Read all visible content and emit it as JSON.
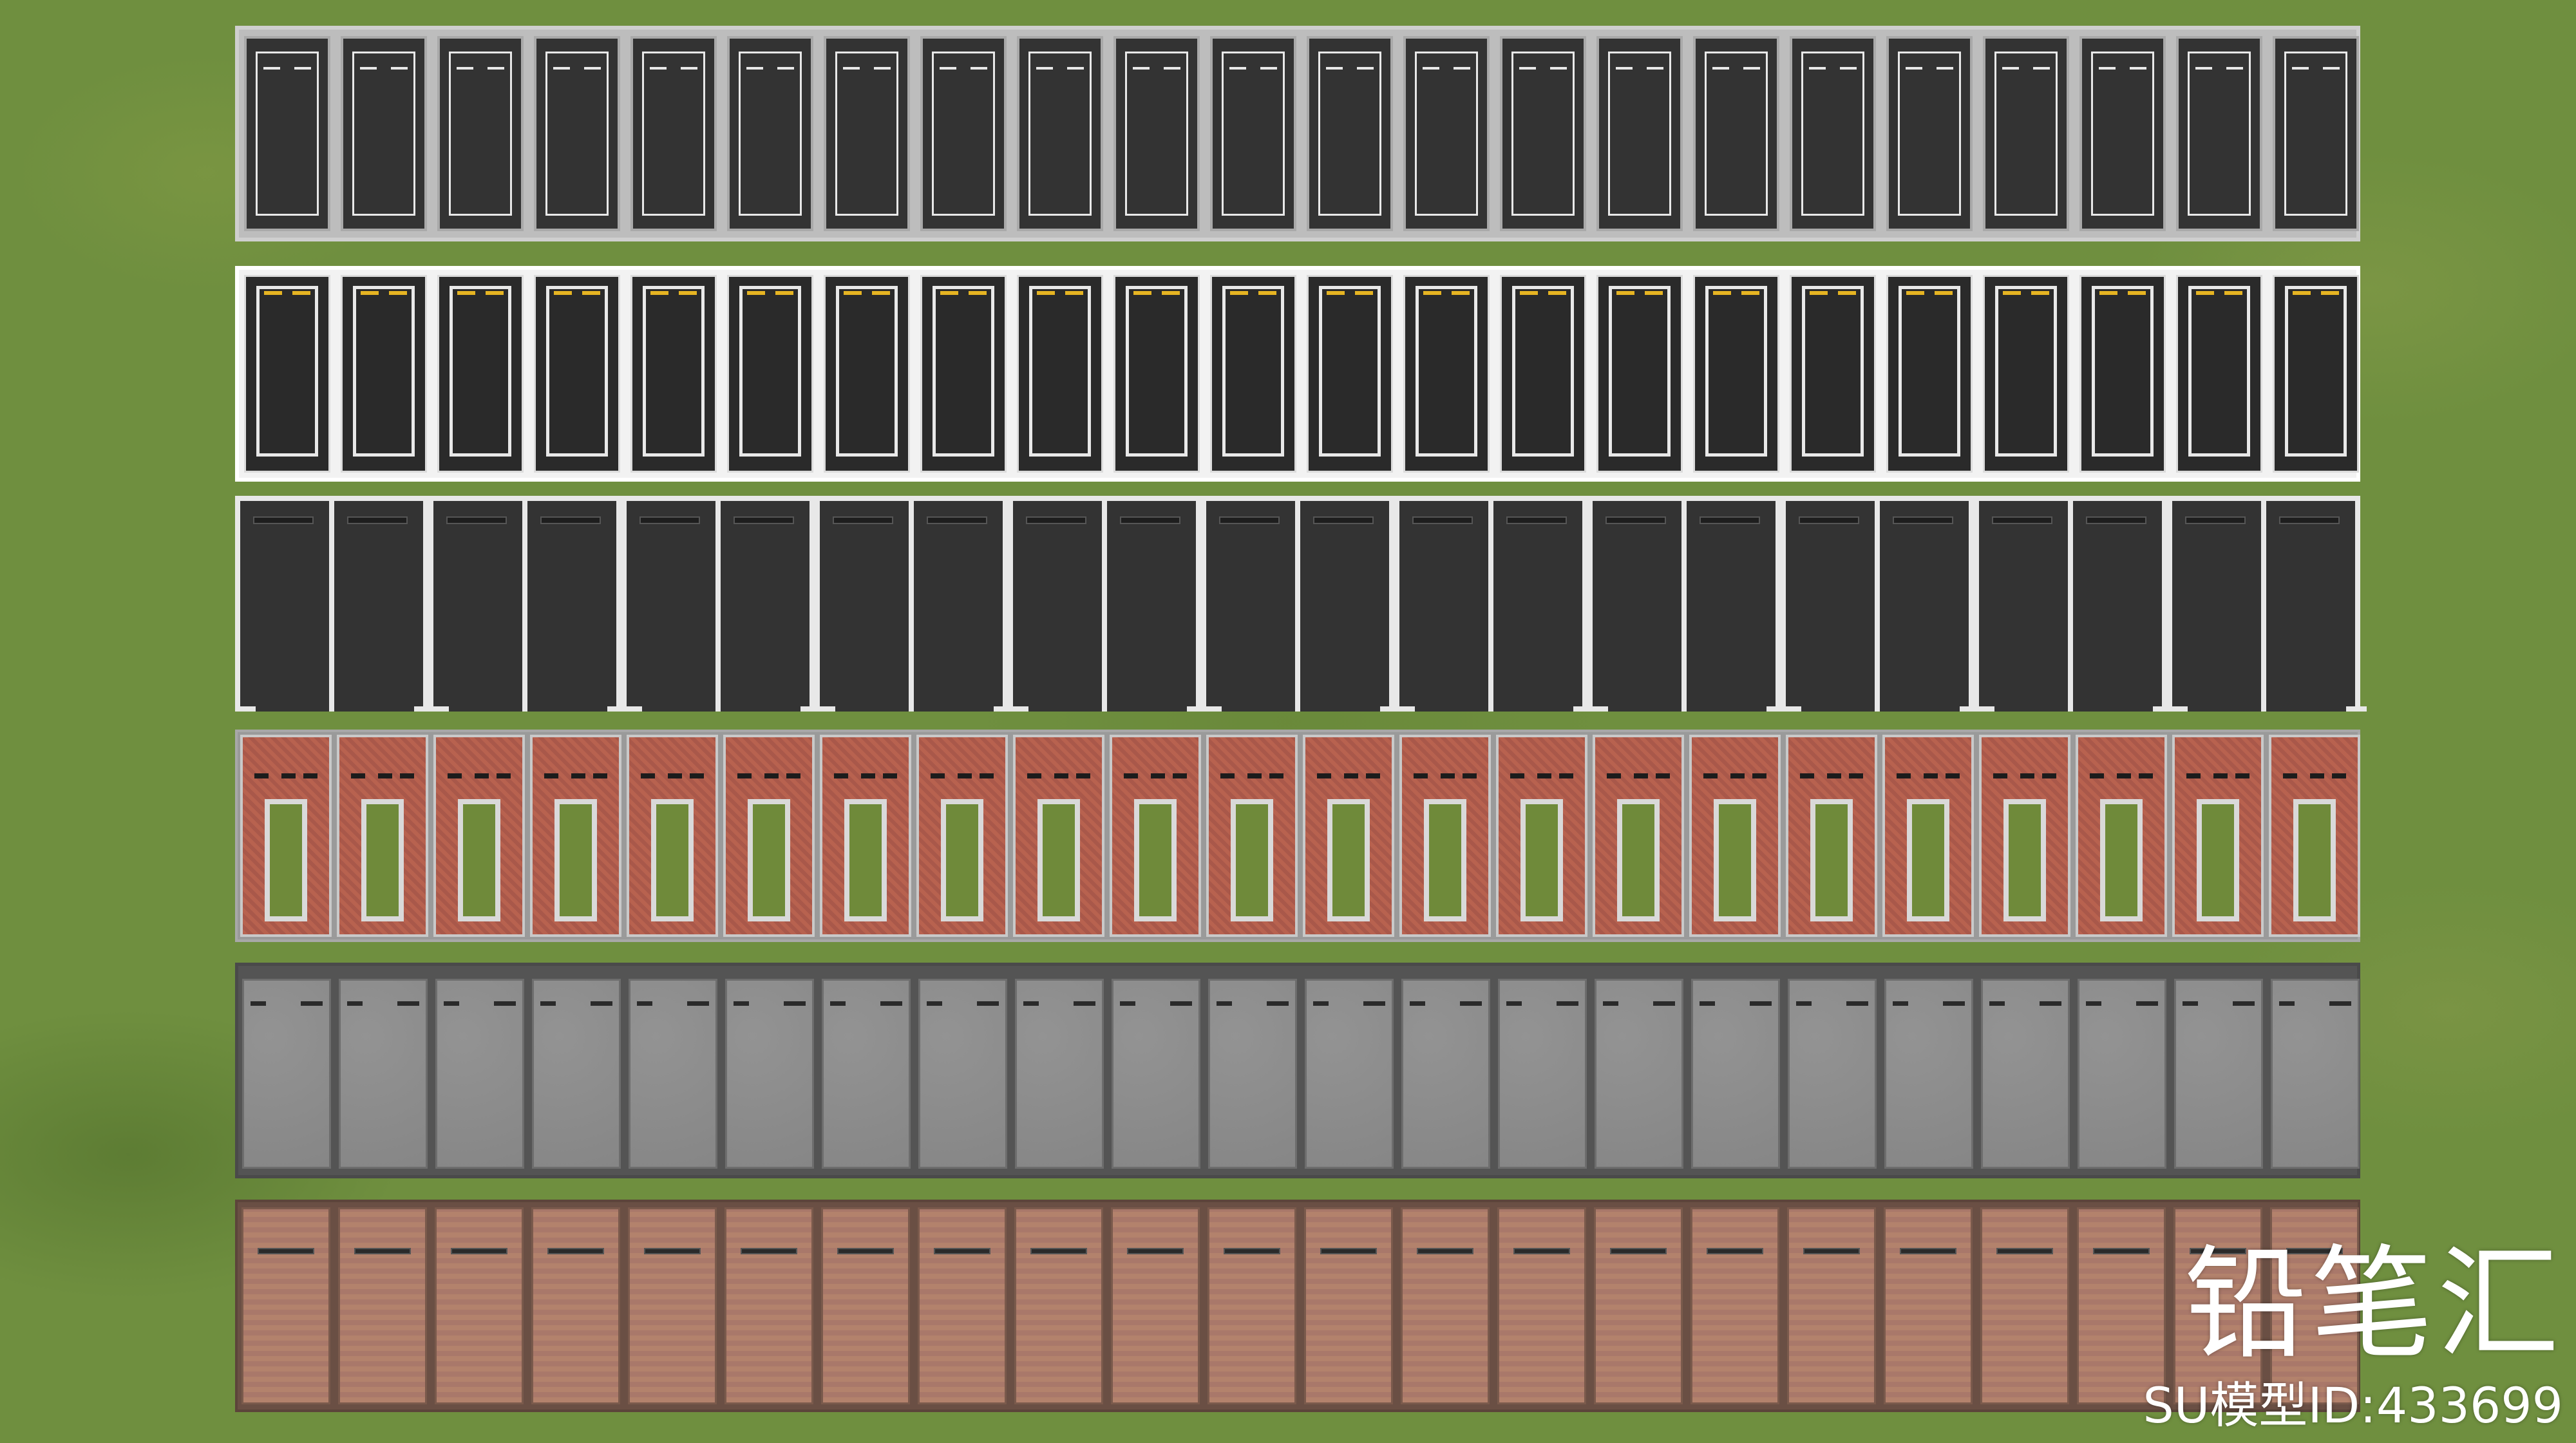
{
  "watermark": {
    "brand": "铅笔汇",
    "model_id": "SU模型ID:433699"
  },
  "colors": {
    "grass": "#6f8f3f",
    "asphalt": "#333333",
    "asphalt_dark": "#2a2a2a",
    "line_white": "#e8e8e8",
    "line_yellow": "#e6b422",
    "red_paver": "#b5614f",
    "gray_paver": "#8c8c8c",
    "gray_border": "#545454",
    "brown_paver": "#b0806a",
    "brown_border": "#6a4f44"
  },
  "rows": [
    {
      "style": "asphalt-dashed-box",
      "count": 22
    },
    {
      "style": "asphalt-yellow-box",
      "count": 22
    },
    {
      "style": "asphalt-paired",
      "count": 22
    },
    {
      "style": "red-paver-ring",
      "count": 22
    },
    {
      "style": "gray-paver",
      "count": 22
    },
    {
      "style": "brown-paver",
      "count": 22
    }
  ]
}
